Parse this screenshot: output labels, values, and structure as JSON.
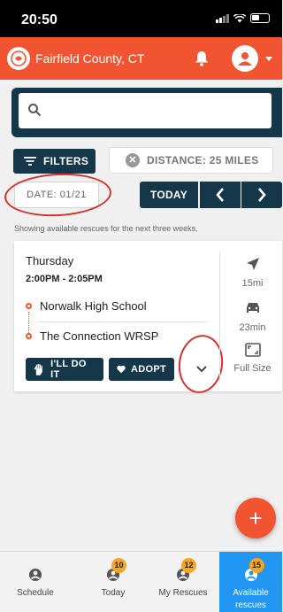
{
  "status_bar": {
    "time": "20:50"
  },
  "header": {
    "location": "Fairfield County, CT"
  },
  "search": {
    "placeholder": ""
  },
  "filters": {
    "filters_label": "FILTERS",
    "distance_label": "DISTANCE: 25 MILES"
  },
  "date_nav": {
    "date_label": "DATE: 01/21",
    "today_label": "TODAY"
  },
  "info_text": "Showing available rescues for the next three weeks.",
  "rescue_card": {
    "day": "Thursday",
    "time": "2:00PM - 2:05PM",
    "pickup": "Norwalk High School",
    "dropoff": "The Connection WRSP",
    "do_it_label": "I'LL DO IT",
    "adopt_label": "ADOPT",
    "distance": "15mi",
    "duration": "23min",
    "full_size_label": "Full Size"
  },
  "bottom_nav": [
    {
      "label": "Schedule",
      "badge": "",
      "icon": "person-icon"
    },
    {
      "label": "Today",
      "badge": "10",
      "icon": "person-icon"
    },
    {
      "label": "My Rescues",
      "badge": "12",
      "icon": "person-icon"
    },
    {
      "label": "Available rescues",
      "badge": "15",
      "icon": "person-icon",
      "active": true
    }
  ],
  "colors": {
    "brand": "#f05431",
    "navy": "#14384a",
    "active": "#2196f3",
    "badge": "#f5a623",
    "annotation": "#d0322e"
  }
}
